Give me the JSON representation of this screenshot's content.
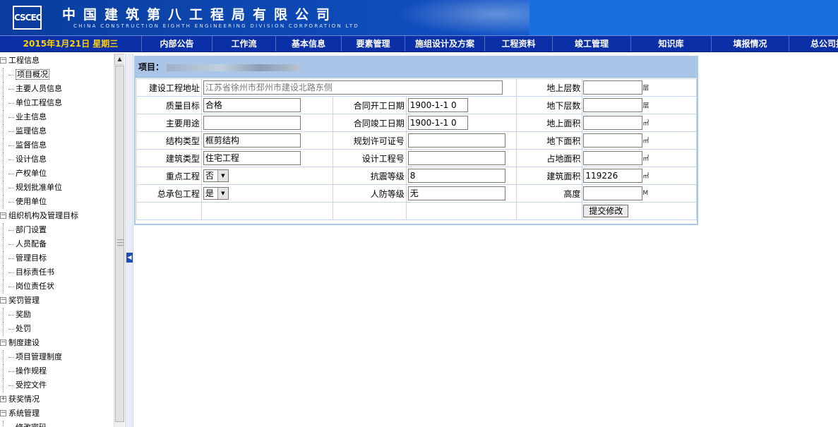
{
  "header": {
    "logo_text": "CSCEC",
    "company_cn": "中国建筑第八工程局有限公司",
    "company_en": "CHINA CONSTRUCTION EIGHTH ENGINEERING DIVISION CORPORATION LTD"
  },
  "nav": {
    "date": "2015年1月21日 星期三",
    "items": [
      "内部公告",
      "工作流",
      "基本信息",
      "要素管理",
      "施组设计及方案",
      "工程资料",
      "竣工管理",
      "知识库",
      "填报情况",
      "总公司报"
    ]
  },
  "sidebar": {
    "groups": [
      {
        "label": "工程信息",
        "children": [
          "项目概况",
          "主要人员信息",
          "单位工程信息",
          "业主信息",
          "监理信息",
          "监督信息",
          "设计信息",
          "产权单位",
          "规划批准单位",
          "使用单位"
        ]
      },
      {
        "label": "组织机构及管理目标",
        "children": [
          "部门设置",
          "人员配备",
          "管理目标",
          "目标责任书",
          "岗位责任状"
        ]
      },
      {
        "label": "奖罚管理",
        "children": [
          "奖励",
          "处罚"
        ]
      },
      {
        "label": "制度建设",
        "children": [
          "项目管理制度",
          "操作规程",
          "受控文件"
        ]
      },
      {
        "label": "获奖情况",
        "children": []
      },
      {
        "label": "系统管理",
        "children": [
          "修改密码"
        ]
      }
    ],
    "selected": "项目概况"
  },
  "form": {
    "title_label": "项目：",
    "address_label": "建设工程地址",
    "address_value": "江苏省徐州市邳州市建设北路东侧",
    "quality_label": "质量目标",
    "quality_value": "合格",
    "use_label": "主要用途",
    "use_value": "",
    "structure_label": "结构类型",
    "structure_value": "框剪结构",
    "building_type_label": "建筑类型",
    "building_type_value": "住宅工程",
    "key_project_label": "重点工程",
    "key_project_value": "否",
    "general_contract_label": "总承包工程",
    "general_contract_value": "是",
    "contract_start_label": "合同开工日期",
    "contract_start_value": "1900-1-1 0",
    "contract_end_label": "合同竣工日期",
    "contract_end_value": "1900-1-1 0",
    "planning_permit_label": "规划许可证号",
    "planning_permit_value": "",
    "design_no_label": "设计工程号",
    "design_no_value": "",
    "seismic_label": "抗震等级",
    "seismic_value": "8",
    "civil_defense_label": "人防等级",
    "civil_defense_value": "无",
    "floors_above_label": "地上层数",
    "floors_above_value": "",
    "floors_above_unit": "层",
    "floors_below_label": "地下层数",
    "floors_below_value": "",
    "floors_below_unit": "层",
    "area_above_label": "地上面积",
    "area_above_value": "",
    "area_below_label": "地下面积",
    "area_below_value": "",
    "land_area_label": "占地面积",
    "land_area_value": "",
    "building_area_label": "建筑面积",
    "building_area_value": "119226",
    "area_unit": "㎡",
    "height_label": "高度",
    "height_value": "",
    "height_unit": "M",
    "submit_label": "提交修改"
  }
}
